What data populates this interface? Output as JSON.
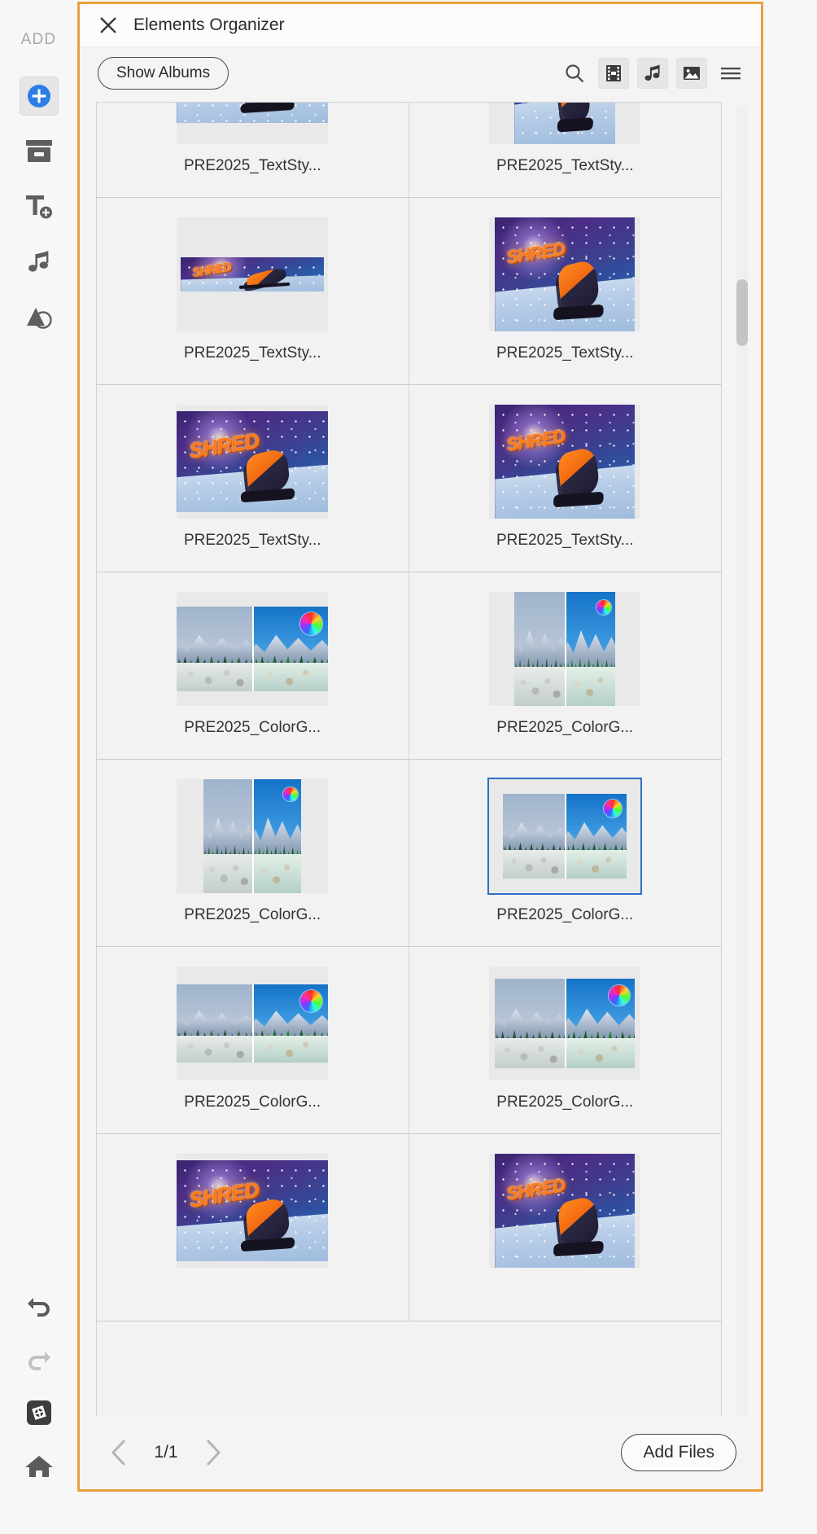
{
  "rail": {
    "label": "ADD",
    "items": [
      {
        "name": "add-media",
        "icon": "plus-circle-icon",
        "active": true
      },
      {
        "name": "add-graphic",
        "icon": "archive-box-icon",
        "active": false
      },
      {
        "name": "add-text",
        "icon": "text-add-icon",
        "active": false
      },
      {
        "name": "add-audio",
        "icon": "music-note-icon",
        "active": false
      },
      {
        "name": "add-shape",
        "icon": "shapes-icon",
        "active": false
      }
    ],
    "bottom_items": [
      {
        "name": "undo",
        "icon": "undo-arrow-icon"
      },
      {
        "name": "redo",
        "icon": "redo-arrow-icon"
      },
      {
        "name": "settings",
        "icon": "media-settings-icon"
      },
      {
        "name": "home",
        "icon": "home-icon"
      }
    ]
  },
  "dialog": {
    "title": "Elements Organizer",
    "close_icon": "close-icon",
    "border_color": "#e8a13c",
    "toolbar": {
      "show_albums_label": "Show Albums",
      "icons": [
        {
          "name": "search",
          "icon": "search-icon",
          "boxed": false,
          "active": false
        },
        {
          "name": "filter-video",
          "icon": "film-strip-icon",
          "boxed": true,
          "active": true
        },
        {
          "name": "filter-audio",
          "icon": "music-note-icon",
          "boxed": true,
          "active": true
        },
        {
          "name": "filter-photo",
          "icon": "photo-icon",
          "boxed": true,
          "active": true
        },
        {
          "name": "more-options",
          "icon": "hamburger-menu-icon",
          "boxed": false,
          "active": false
        }
      ]
    },
    "grid": {
      "items": [
        {
          "label": "PRE2025_TextSty...",
          "art": "shred",
          "variant": "wide-crop",
          "selected": false
        },
        {
          "label": "PRE2025_TextSty...",
          "art": "shred",
          "variant": "tall",
          "selected": false
        },
        {
          "label": "PRE2025_TextSty...",
          "art": "shred",
          "variant": "banner",
          "selected": false
        },
        {
          "label": "PRE2025_TextSty...",
          "art": "shred",
          "variant": "portrait",
          "selected": false
        },
        {
          "label": "PRE2025_TextSty...",
          "art": "shred",
          "variant": "landscape",
          "selected": false
        },
        {
          "label": "PRE2025_TextSty...",
          "art": "shred",
          "variant": "portrait",
          "selected": false
        },
        {
          "label": "PRE2025_ColorG...",
          "art": "colorgrade",
          "variant": "landscape",
          "selected": false
        },
        {
          "label": "PRE2025_ColorG...",
          "art": "colorgrade",
          "variant": "portrait",
          "selected": false
        },
        {
          "label": "PRE2025_ColorG...",
          "art": "colorgrade",
          "variant": "portrait",
          "selected": false
        },
        {
          "label": "PRE2025_ColorG...",
          "art": "colorgrade",
          "variant": "landscape",
          "selected": true
        },
        {
          "label": "PRE2025_ColorG...",
          "art": "colorgrade",
          "variant": "wide",
          "selected": false
        },
        {
          "label": "PRE2025_ColorG...",
          "art": "colorgrade",
          "variant": "portrait",
          "selected": false
        },
        {
          "label": "",
          "art": "shred",
          "variant": "landscape",
          "selected": false
        },
        {
          "label": "",
          "art": "shred",
          "variant": "portrait",
          "selected": false
        }
      ],
      "selection_color": "#2f6fc4"
    },
    "footer": {
      "prev_icon": "chevron-left-icon",
      "next_icon": "chevron-right-icon",
      "page_count": "1/1",
      "add_files_label": "Add Files"
    }
  }
}
